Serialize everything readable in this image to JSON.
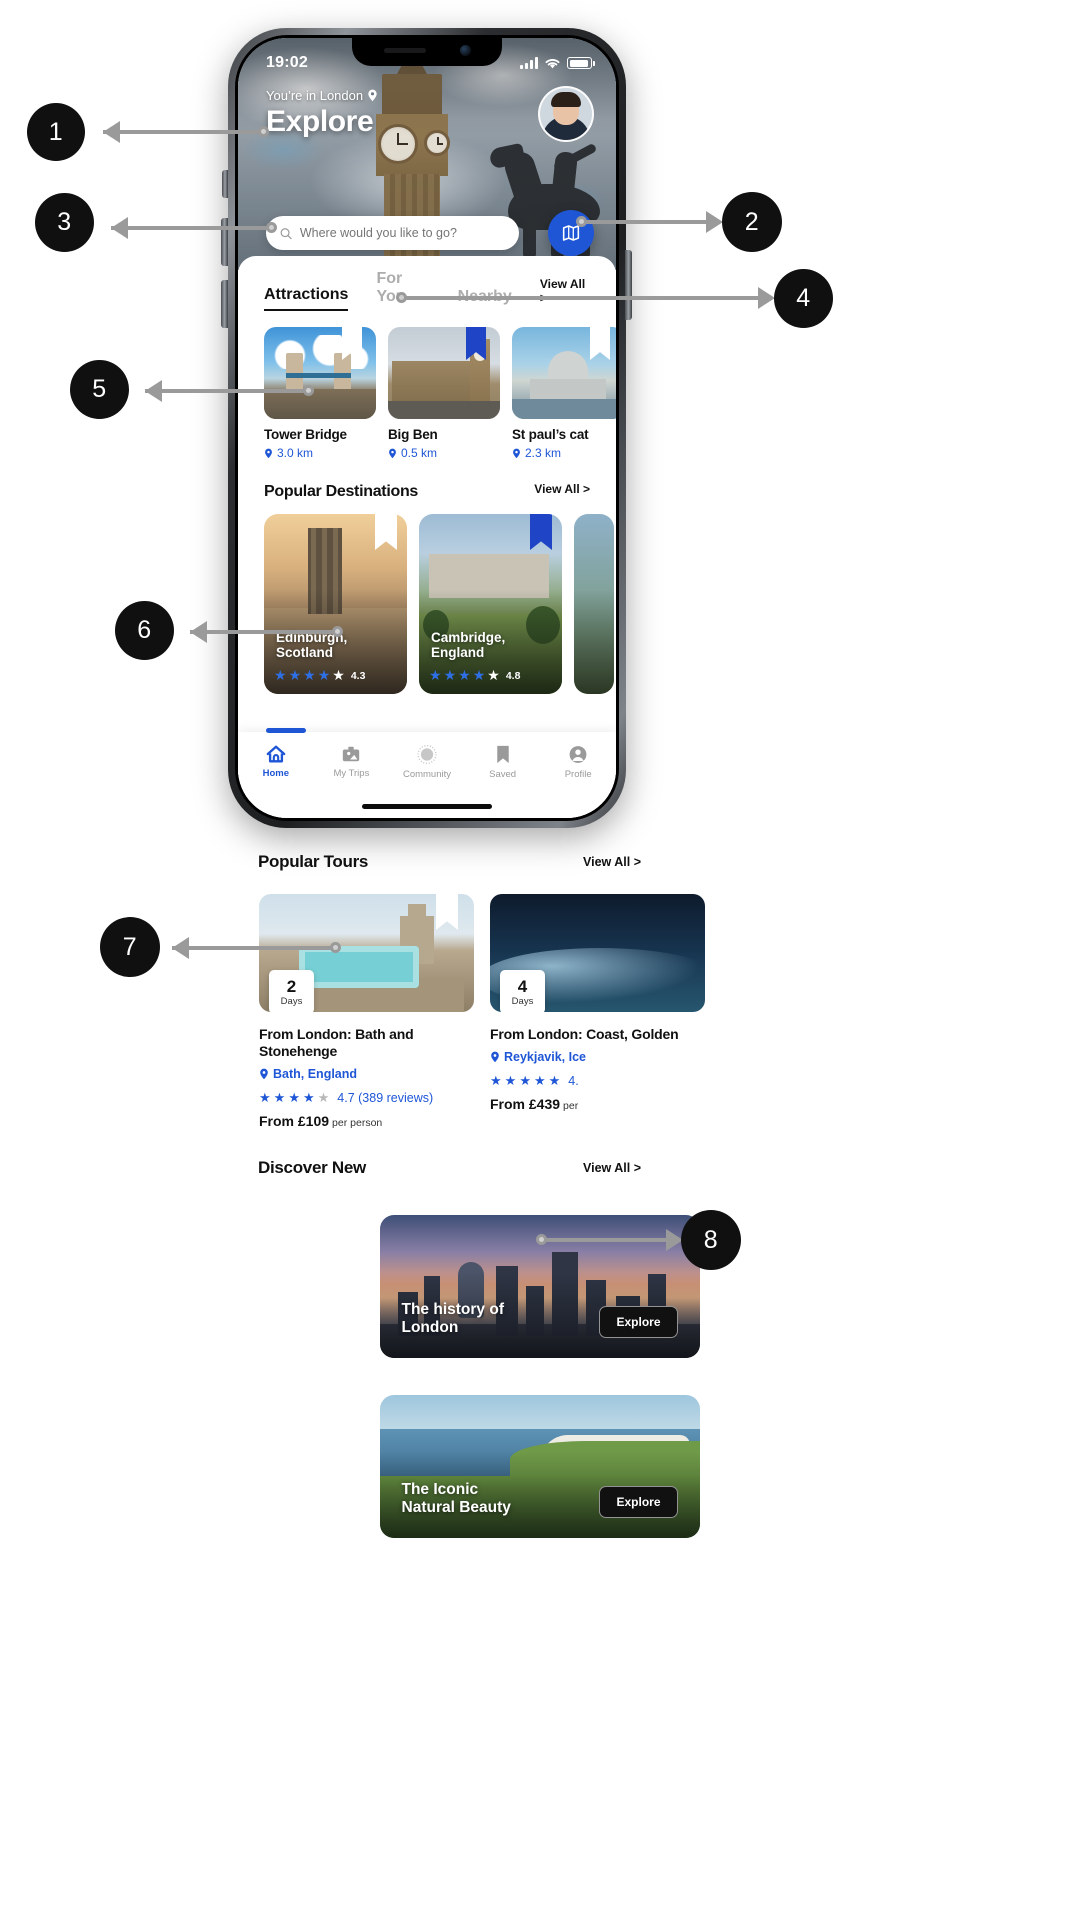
{
  "annotations": [
    {
      "num": "1"
    },
    {
      "num": "2"
    },
    {
      "num": "3"
    },
    {
      "num": "4"
    },
    {
      "num": "5"
    },
    {
      "num": "6"
    },
    {
      "num": "7"
    },
    {
      "num": "8"
    }
  ],
  "status_bar": {
    "time": "19:02"
  },
  "hero": {
    "location_text": "You’re in London",
    "title": "Explore",
    "pin_icon": "location-pin-icon",
    "avatar_icon": "user-avatar",
    "map_button_icon": "map-explore-icon"
  },
  "search": {
    "placeholder": "Where would you like to go?",
    "value": "",
    "icon": "search-icon"
  },
  "tabs": {
    "items": [
      {
        "label": "Attractions",
        "active": true
      },
      {
        "label": "For You",
        "active": false
      },
      {
        "label": "Nearby",
        "active": false
      }
    ],
    "view_all": "View All >"
  },
  "attractions": {
    "items": [
      {
        "name": "Tower Bridge",
        "distance": "3.0 km",
        "bookmark": "white"
      },
      {
        "name": "Big Ben",
        "distance": "0.5 km",
        "bookmark": "blue"
      },
      {
        "name": "St paul’s cat",
        "distance": "2.3 km",
        "bookmark": "white"
      }
    ]
  },
  "popular_destinations": {
    "title": "Popular Destinations",
    "view_all": "View All >",
    "items": [
      {
        "name": "Edinburgh,\nScotland",
        "line1": "Edinburgh,",
        "line2": "Scotland",
        "rating": "4.3",
        "stars": 4,
        "bookmark": "white"
      },
      {
        "name": "Cambridge,\nEngland",
        "line1": "Cambridge,",
        "line2": "England",
        "rating": "4.8",
        "stars": 5,
        "bookmark": "blue"
      }
    ]
  },
  "bottom_nav": {
    "items": [
      {
        "label": "Home",
        "icon": "home-icon",
        "active": true
      },
      {
        "label": "My Trips",
        "icon": "suitcase-icon",
        "active": false
      },
      {
        "label": "Community",
        "icon": "globe-icon",
        "active": false
      },
      {
        "label": "Saved",
        "icon": "bookmark-icon",
        "active": false
      },
      {
        "label": "Profile",
        "icon": "profile-icon",
        "active": false
      }
    ]
  },
  "popular_tours": {
    "title": "Popular Tours",
    "view_all": "View All >",
    "items": [
      {
        "days": "2",
        "days_label": "Days",
        "name": "From London: Bath and Stonehenge",
        "location": "Bath, England",
        "stars": 4,
        "rating_text": "4.7 (389 reviews)",
        "price_prefix": "From £109",
        "price_suffix": "per person",
        "bookmark": "white"
      },
      {
        "days": "4",
        "days_label": "Days",
        "name": "From London: Coast, Golden",
        "location": "Reykjavik, Ice",
        "stars": 5,
        "rating_text": "4.",
        "price_prefix": "From £439",
        "price_suffix": "per",
        "bookmark": "white"
      }
    ]
  },
  "discover_new": {
    "title": "Discover New",
    "view_all": "View All >",
    "items": [
      {
        "title_line1": "The history of",
        "title_line2": "London",
        "button": "Explore"
      },
      {
        "title_line1": "The Iconic",
        "title_line2": "Natural Beauty",
        "button": "Explore"
      }
    ]
  },
  "colors": {
    "accent": "#1f56d6",
    "ribbon_blue": "#1f45c6",
    "text": "#111111",
    "muted": "#9a9a9a"
  }
}
